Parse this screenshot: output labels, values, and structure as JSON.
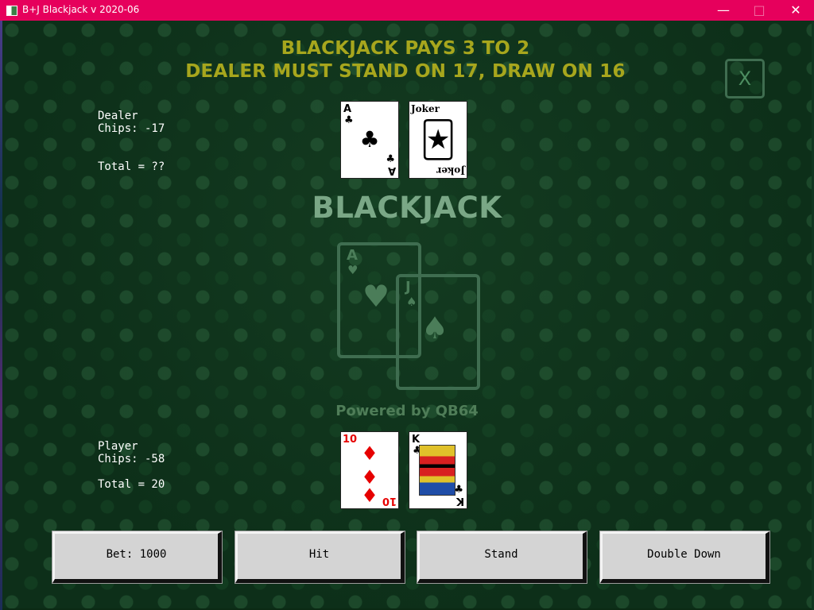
{
  "window": {
    "title": "B+J Blackjack v 2020-06",
    "controls": {
      "minimize": "—",
      "maximize": "□",
      "close": "✕"
    }
  },
  "table": {
    "headline_1": "BLACKJACK PAYS 3 TO 2",
    "headline_2": "DEALER MUST STAND ON 17, DRAW ON 16",
    "close_button": "X",
    "brand": "BLACKJACK",
    "powered": "Powered by QB64"
  },
  "dealer": {
    "name": "Dealer",
    "chips": "Chips: -17",
    "total": "Total = ??",
    "cards": [
      {
        "rank": "A",
        "suit": "♣",
        "color": "#000000"
      },
      {
        "label": "Joker",
        "label_bottom": "Joker",
        "rank": "🃏",
        "color": "#000000"
      }
    ]
  },
  "player": {
    "name": "Player",
    "chips": "Chips: -58",
    "total": "Total = 20",
    "cards": [
      {
        "rank": "10",
        "suit": "♦",
        "color": "#e60000"
      },
      {
        "rank": "K",
        "suit": "♣",
        "color": "#000000"
      }
    ]
  },
  "logo_cards": [
    {
      "rank": "A",
      "suit": "♥"
    },
    {
      "rank": "J",
      "suit": "♠"
    }
  ],
  "actions": {
    "bet": "Bet: 1000",
    "hit": "Hit",
    "stand": "Stand",
    "double_down": "Double Down"
  },
  "colors": {
    "titlebar": "#e6005c",
    "felt": "#0d2f19",
    "headline": "#a7a61d",
    "brand": "#7aa786"
  }
}
